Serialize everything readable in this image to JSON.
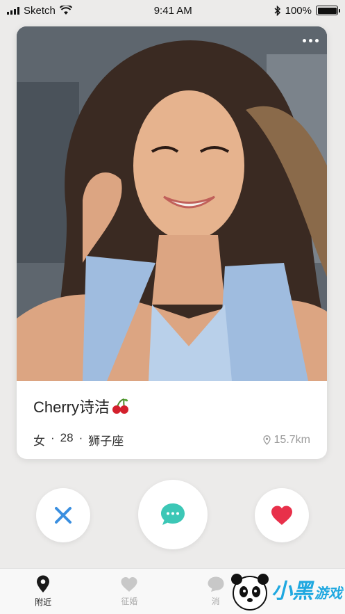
{
  "status_bar": {
    "carrier": "Sketch",
    "time": "9:41 AM",
    "battery": "100%"
  },
  "profile": {
    "name": "Cherry诗洁",
    "gender": "女",
    "age": "28",
    "zodiac": "狮子座",
    "separator": "·",
    "distance": "15.7km"
  },
  "tabs": [
    {
      "label": "附近",
      "icon": "location-pin-icon",
      "active": true
    },
    {
      "label": "征婚",
      "icon": "heart-icon",
      "active": false
    },
    {
      "label": "消",
      "icon": "chat-icon",
      "active": false
    }
  ],
  "watermark": {
    "text": "小黑",
    "sub": "游戏"
  },
  "colors": {
    "dislike": "#3a8fe0",
    "chat": "#3cc7b6",
    "like": "#e8304a"
  }
}
